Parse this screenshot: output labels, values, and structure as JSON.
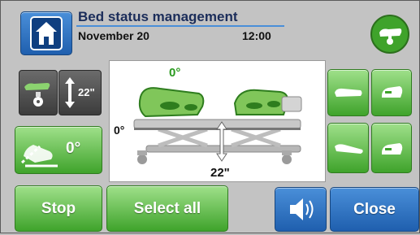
{
  "header": {
    "title": "Bed status management",
    "date": "November 20",
    "time": "12:00"
  },
  "left": {
    "height_value": "22\"",
    "tilt_value": "0°"
  },
  "bed": {
    "backrest_angle": "0°",
    "tilt_angle": "0°",
    "height": "22\""
  },
  "buttons": {
    "stop": "Stop",
    "select_all": "Select all",
    "close": "Close"
  },
  "colors": {
    "accent_blue": "#1f5fae",
    "accent_green": "#3fa32b",
    "angle_green": "#2a9a1f"
  }
}
